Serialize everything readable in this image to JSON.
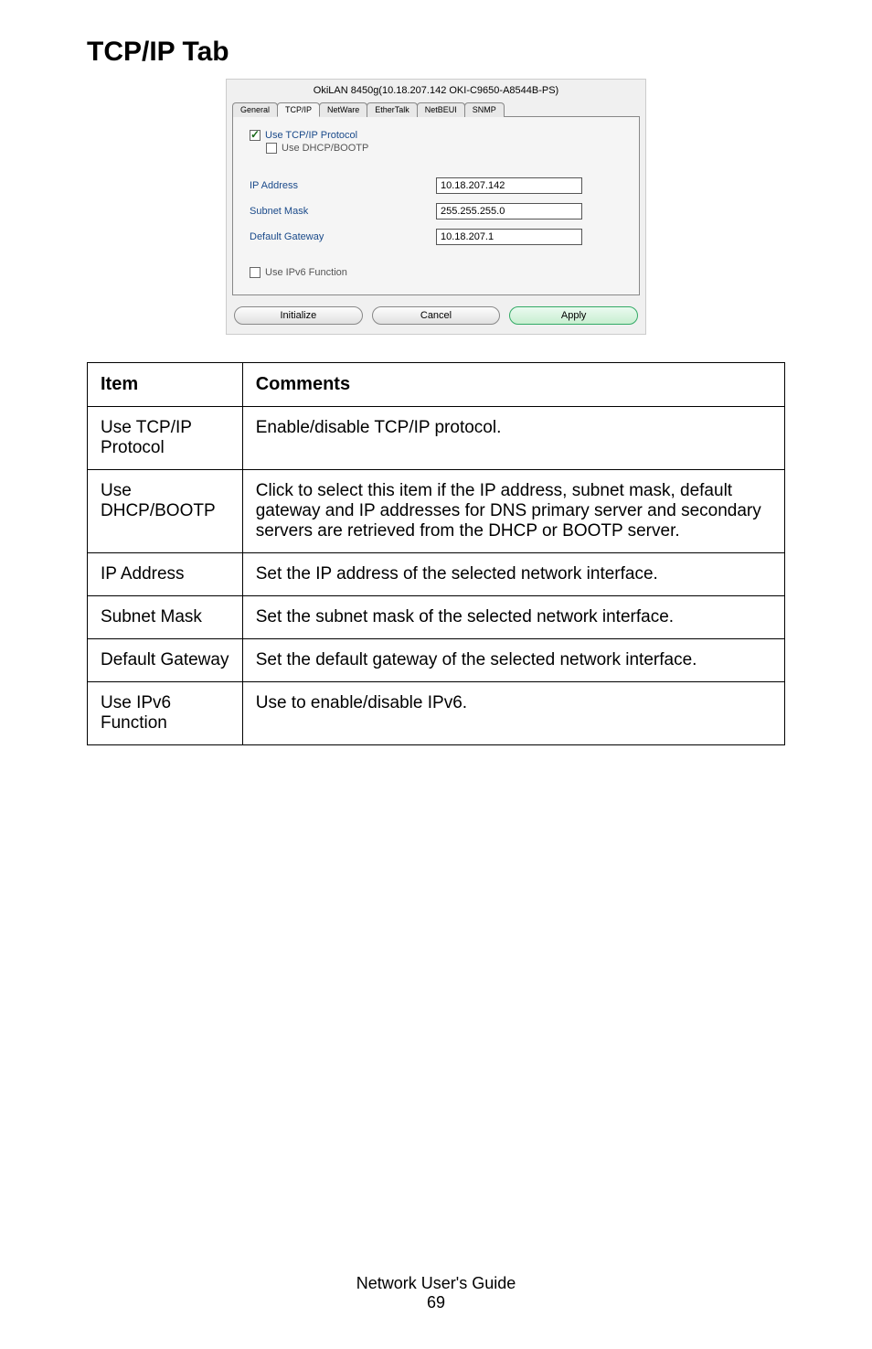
{
  "heading": "TCP/IP Tab",
  "dialog": {
    "title": "OkiLAN 8450g(10.18.207.142 OKI-C9650-A8544B-PS)",
    "tabs": {
      "general": "General",
      "tcpip": "TCP/IP",
      "netware": "NetWare",
      "ethertalk": "EtherTalk",
      "netbeui": "NetBEUI",
      "snmp": "SNMP"
    },
    "use_tcpip_label": "Use TCP/IP Protocol",
    "use_dhcp_label": "Use DHCP/BOOTP",
    "fields": {
      "ip_label": "IP Address",
      "ip_value": "10.18.207.142",
      "mask_label": "Subnet Mask",
      "mask_value": "255.255.255.0",
      "gw_label": "Default Gateway",
      "gw_value": "10.18.207.1"
    },
    "ipv6_label": "Use IPv6 Function",
    "buttons": {
      "initialize": "Initialize",
      "cancel": "Cancel",
      "apply": "Apply"
    }
  },
  "table": {
    "head_item": "Item",
    "head_comments": "Comments",
    "rows": [
      {
        "item": "Use TCP/IP Protocol",
        "comment": "Enable/disable TCP/IP protocol."
      },
      {
        "item": "Use DHCP/BOOTP",
        "comment": "Click to select this item if the IP address, subnet mask, default gateway and IP addresses for DNS primary server and secondary servers are retrieved from the DHCP or BOOTP server."
      },
      {
        "item": "IP Address",
        "comment": "Set the IP address of the selected network interface."
      },
      {
        "item": "Subnet Mask",
        "comment": "Set the subnet mask of the selected network interface."
      },
      {
        "item": "Default Gateway",
        "comment": "Set the default gateway of the selected network interface."
      },
      {
        "item": "Use IPv6 Function",
        "comment": "Use to enable/disable IPv6."
      }
    ]
  },
  "footer": {
    "line1": "Network User's Guide",
    "line2": "69"
  }
}
